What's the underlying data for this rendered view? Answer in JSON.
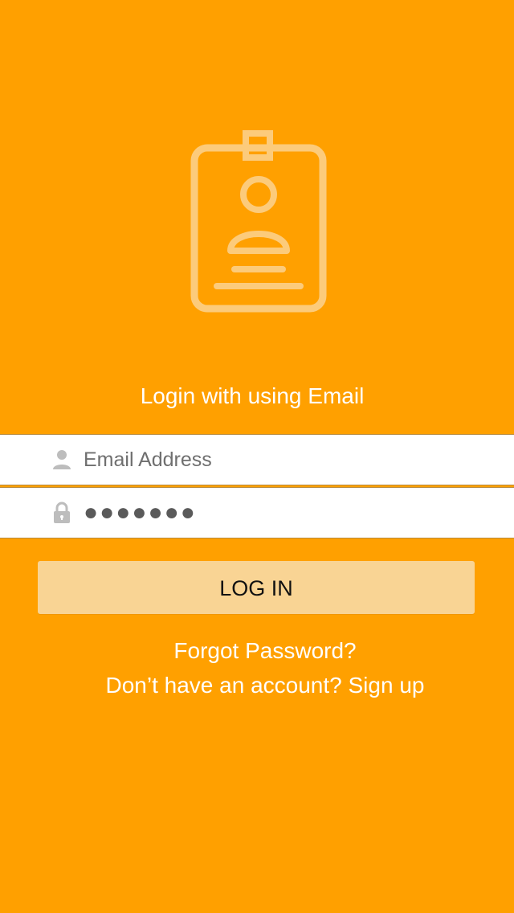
{
  "colors": {
    "background": "#FFA000",
    "field_background": "#FFFFFF",
    "field_border": "#B78A3E",
    "button_background": "#F9D494",
    "button_text": "#111111",
    "text_light": "#FFFFFF",
    "input_text": "#6F6F6F",
    "icon_gray": "#BDBDBD",
    "badge_icon": "#FCCB7B"
  },
  "header": {
    "title": "Login with using Email",
    "badge_icon": "id-badge-icon"
  },
  "form": {
    "email": {
      "icon": "person-icon",
      "placeholder": "Email Address",
      "value": ""
    },
    "password": {
      "icon": "lock-icon",
      "value": "●●●●●●●"
    },
    "login_button": {
      "label": "LOG IN"
    }
  },
  "links": {
    "forgot_password": "Forgot Password?",
    "signup_prompt": "Don’t have an account? Sign up"
  }
}
